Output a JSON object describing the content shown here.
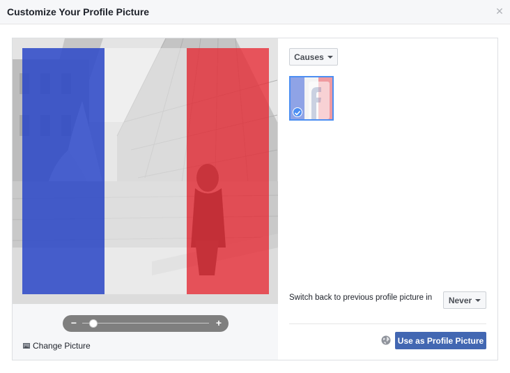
{
  "dialog": {
    "title": "Customize Your Profile Picture",
    "close_icon": "close-icon"
  },
  "editor": {
    "zoom": {
      "minus_label": "−",
      "plus_label": "+",
      "level": 0.09
    },
    "change_picture_label": "Change Picture",
    "change_picture_icon": "picture-icon",
    "overlay_colors": [
      "#2a46c8",
      "#ffffff",
      "#e8232e"
    ]
  },
  "options": {
    "category_dropdown": {
      "label": "Causes"
    },
    "frames": [
      {
        "name": "France flag frame",
        "selected": true
      }
    ],
    "switch_back": {
      "label": "Switch back to previous profile picture in",
      "selected": "Never"
    },
    "privacy_icon": "globe-icon",
    "submit_label": "Use as Profile Picture"
  },
  "colors": {
    "accent": "#4267b2",
    "selection": "#4c8ef2"
  }
}
